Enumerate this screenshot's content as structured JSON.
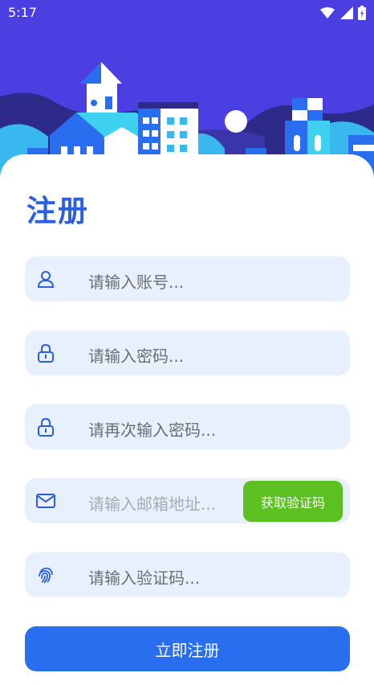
{
  "status_bar": {
    "time": "5:17",
    "wifi_icon": "wifi-icon",
    "signal_icon": "signal-icon",
    "battery_icon": "battery-icon"
  },
  "hero": {
    "illustration": "city-skyline-illustration"
  },
  "form": {
    "title": "注册",
    "account_placeholder": "请输入账号...",
    "password_placeholder": "请输入密码...",
    "confirm_password_placeholder": "请再次输入密码...",
    "email_placeholder": "请输入邮箱地址...",
    "get_code_label": "获取验证码",
    "code_placeholder": "请输入验证码...",
    "submit_label": "立即注册"
  },
  "colors": {
    "hero_bg": "#4b3fe2",
    "title": "#2a5fe0",
    "field_bg": "#e9f0fd",
    "get_code_bg": "#5cc021",
    "submit_bg": "#2a6ef0"
  }
}
